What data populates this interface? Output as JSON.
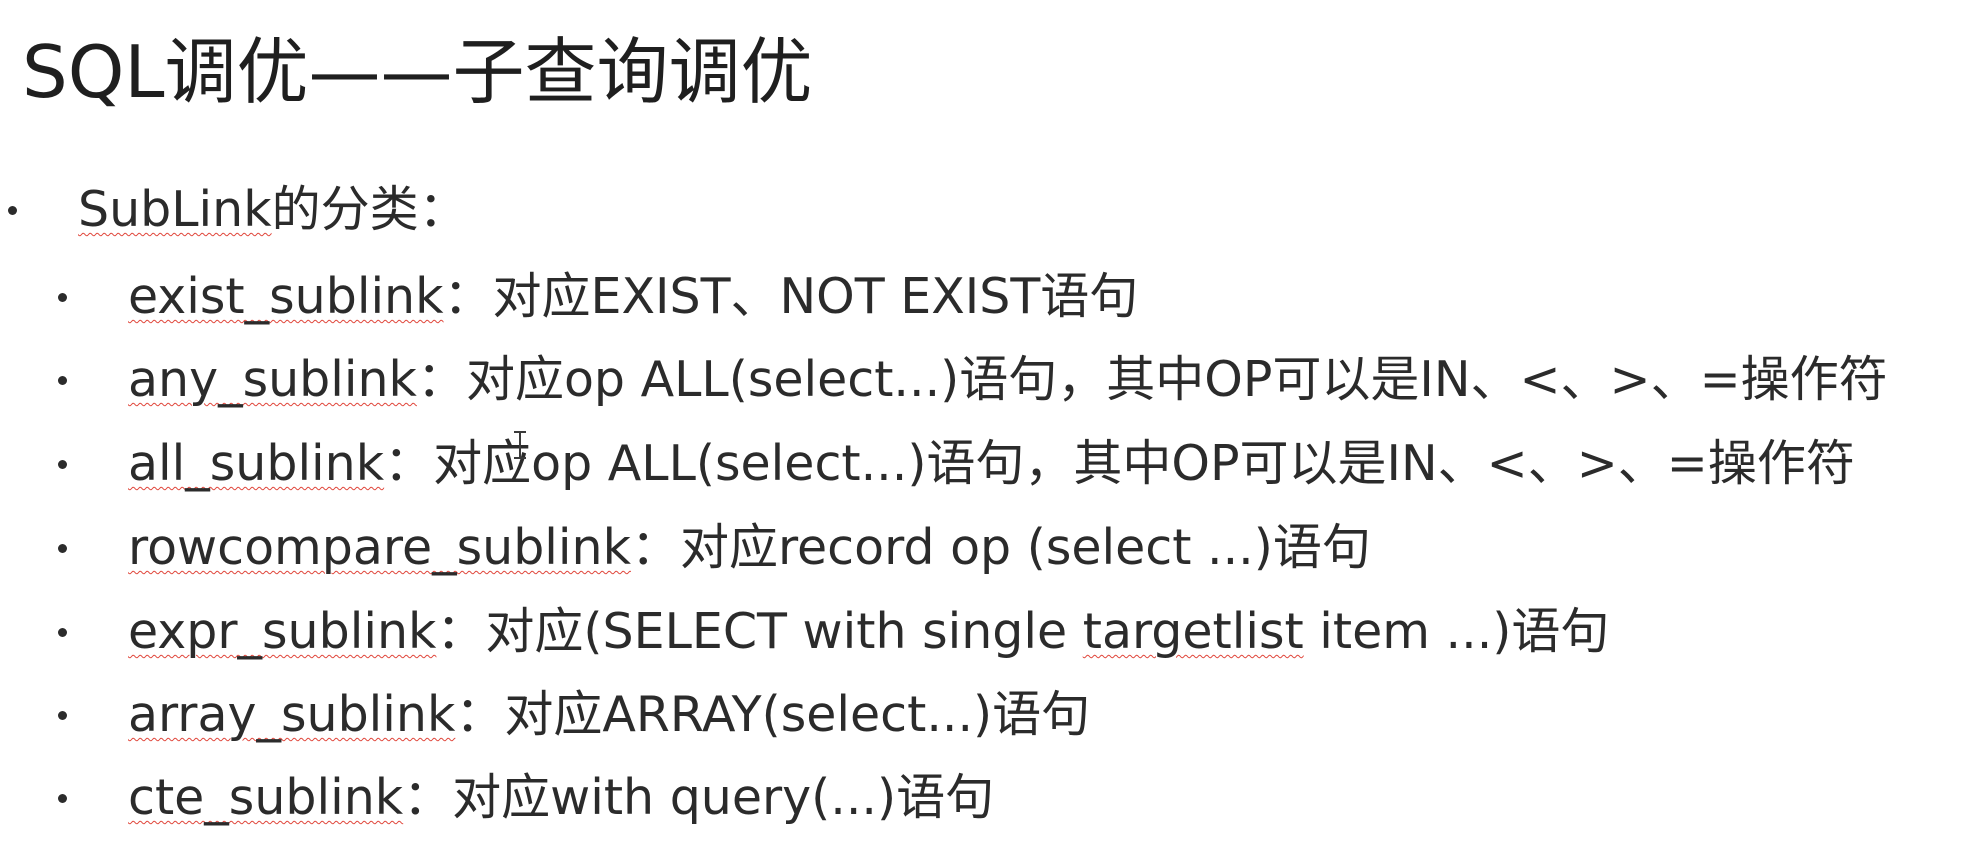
{
  "slide": {
    "title": "SQL调优——子查询调优",
    "heading": {
      "term": "SubLink",
      "rest": "的分类："
    },
    "items": [
      {
        "term": "exist_sublink",
        "rest": "：对应EXIST、NOT EXIST语句"
      },
      {
        "term": "any_sublink",
        "rest": "：对应op ALL(select...)语句，其中OP可以是IN、<、>、=操作符"
      },
      {
        "term": "all_sublink",
        "rest": "：对应op ALL(select...)语句，其中OP可以是IN、<、>、=操作符"
      },
      {
        "term": "rowcompare_sublink",
        "rest": "：对应record op (select ...)语句"
      },
      {
        "term": "expr_sublink",
        "rest_before": "：对应(SELECT with single ",
        "term2": "targetlist",
        "rest_after": " item ...)语句"
      },
      {
        "term": "array_sublink",
        "rest": "：对应ARRAY(select...)语句"
      },
      {
        "term": "cte_sublink",
        "rest": "：对应with query(...)语句"
      }
    ]
  }
}
